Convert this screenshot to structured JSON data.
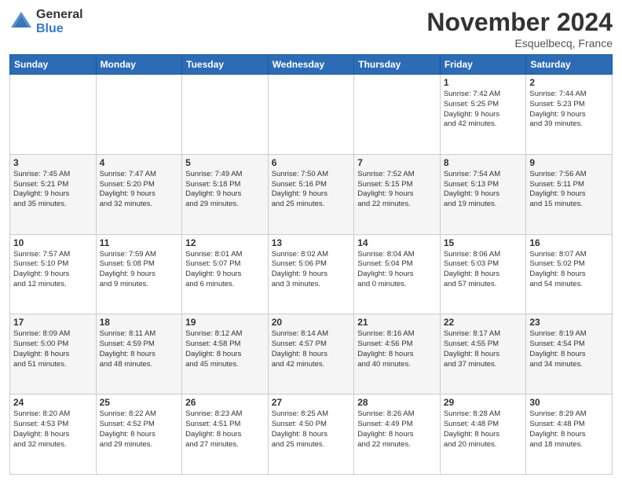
{
  "header": {
    "logo_general": "General",
    "logo_blue": "Blue",
    "month_title": "November 2024",
    "location": "Esquelbecq, France"
  },
  "days_of_week": [
    "Sunday",
    "Monday",
    "Tuesday",
    "Wednesday",
    "Thursday",
    "Friday",
    "Saturday"
  ],
  "weeks": [
    [
      {
        "day": "",
        "info": ""
      },
      {
        "day": "",
        "info": ""
      },
      {
        "day": "",
        "info": ""
      },
      {
        "day": "",
        "info": ""
      },
      {
        "day": "",
        "info": ""
      },
      {
        "day": "1",
        "info": "Sunrise: 7:42 AM\nSunset: 5:25 PM\nDaylight: 9 hours\nand 42 minutes."
      },
      {
        "day": "2",
        "info": "Sunrise: 7:44 AM\nSunset: 5:23 PM\nDaylight: 9 hours\nand 39 minutes."
      }
    ],
    [
      {
        "day": "3",
        "info": "Sunrise: 7:45 AM\nSunset: 5:21 PM\nDaylight: 9 hours\nand 35 minutes."
      },
      {
        "day": "4",
        "info": "Sunrise: 7:47 AM\nSunset: 5:20 PM\nDaylight: 9 hours\nand 32 minutes."
      },
      {
        "day": "5",
        "info": "Sunrise: 7:49 AM\nSunset: 5:18 PM\nDaylight: 9 hours\nand 29 minutes."
      },
      {
        "day": "6",
        "info": "Sunrise: 7:50 AM\nSunset: 5:16 PM\nDaylight: 9 hours\nand 25 minutes."
      },
      {
        "day": "7",
        "info": "Sunrise: 7:52 AM\nSunset: 5:15 PM\nDaylight: 9 hours\nand 22 minutes."
      },
      {
        "day": "8",
        "info": "Sunrise: 7:54 AM\nSunset: 5:13 PM\nDaylight: 9 hours\nand 19 minutes."
      },
      {
        "day": "9",
        "info": "Sunrise: 7:56 AM\nSunset: 5:11 PM\nDaylight: 9 hours\nand 15 minutes."
      }
    ],
    [
      {
        "day": "10",
        "info": "Sunrise: 7:57 AM\nSunset: 5:10 PM\nDaylight: 9 hours\nand 12 minutes."
      },
      {
        "day": "11",
        "info": "Sunrise: 7:59 AM\nSunset: 5:08 PM\nDaylight: 9 hours\nand 9 minutes."
      },
      {
        "day": "12",
        "info": "Sunrise: 8:01 AM\nSunset: 5:07 PM\nDaylight: 9 hours\nand 6 minutes."
      },
      {
        "day": "13",
        "info": "Sunrise: 8:02 AM\nSunset: 5:06 PM\nDaylight: 9 hours\nand 3 minutes."
      },
      {
        "day": "14",
        "info": "Sunrise: 8:04 AM\nSunset: 5:04 PM\nDaylight: 9 hours\nand 0 minutes."
      },
      {
        "day": "15",
        "info": "Sunrise: 8:06 AM\nSunset: 5:03 PM\nDaylight: 8 hours\nand 57 minutes."
      },
      {
        "day": "16",
        "info": "Sunrise: 8:07 AM\nSunset: 5:02 PM\nDaylight: 8 hours\nand 54 minutes."
      }
    ],
    [
      {
        "day": "17",
        "info": "Sunrise: 8:09 AM\nSunset: 5:00 PM\nDaylight: 8 hours\nand 51 minutes."
      },
      {
        "day": "18",
        "info": "Sunrise: 8:11 AM\nSunset: 4:59 PM\nDaylight: 8 hours\nand 48 minutes."
      },
      {
        "day": "19",
        "info": "Sunrise: 8:12 AM\nSunset: 4:58 PM\nDaylight: 8 hours\nand 45 minutes."
      },
      {
        "day": "20",
        "info": "Sunrise: 8:14 AM\nSunset: 4:57 PM\nDaylight: 8 hours\nand 42 minutes."
      },
      {
        "day": "21",
        "info": "Sunrise: 8:16 AM\nSunset: 4:56 PM\nDaylight: 8 hours\nand 40 minutes."
      },
      {
        "day": "22",
        "info": "Sunrise: 8:17 AM\nSunset: 4:55 PM\nDaylight: 8 hours\nand 37 minutes."
      },
      {
        "day": "23",
        "info": "Sunrise: 8:19 AM\nSunset: 4:54 PM\nDaylight: 8 hours\nand 34 minutes."
      }
    ],
    [
      {
        "day": "24",
        "info": "Sunrise: 8:20 AM\nSunset: 4:53 PM\nDaylight: 8 hours\nand 32 minutes."
      },
      {
        "day": "25",
        "info": "Sunrise: 8:22 AM\nSunset: 4:52 PM\nDaylight: 8 hours\nand 29 minutes."
      },
      {
        "day": "26",
        "info": "Sunrise: 8:23 AM\nSunset: 4:51 PM\nDaylight: 8 hours\nand 27 minutes."
      },
      {
        "day": "27",
        "info": "Sunrise: 8:25 AM\nSunset: 4:50 PM\nDaylight: 8 hours\nand 25 minutes."
      },
      {
        "day": "28",
        "info": "Sunrise: 8:26 AM\nSunset: 4:49 PM\nDaylight: 8 hours\nand 22 minutes."
      },
      {
        "day": "29",
        "info": "Sunrise: 8:28 AM\nSunset: 4:48 PM\nDaylight: 8 hours\nand 20 minutes."
      },
      {
        "day": "30",
        "info": "Sunrise: 8:29 AM\nSunset: 4:48 PM\nDaylight: 8 hours\nand 18 minutes."
      }
    ]
  ]
}
